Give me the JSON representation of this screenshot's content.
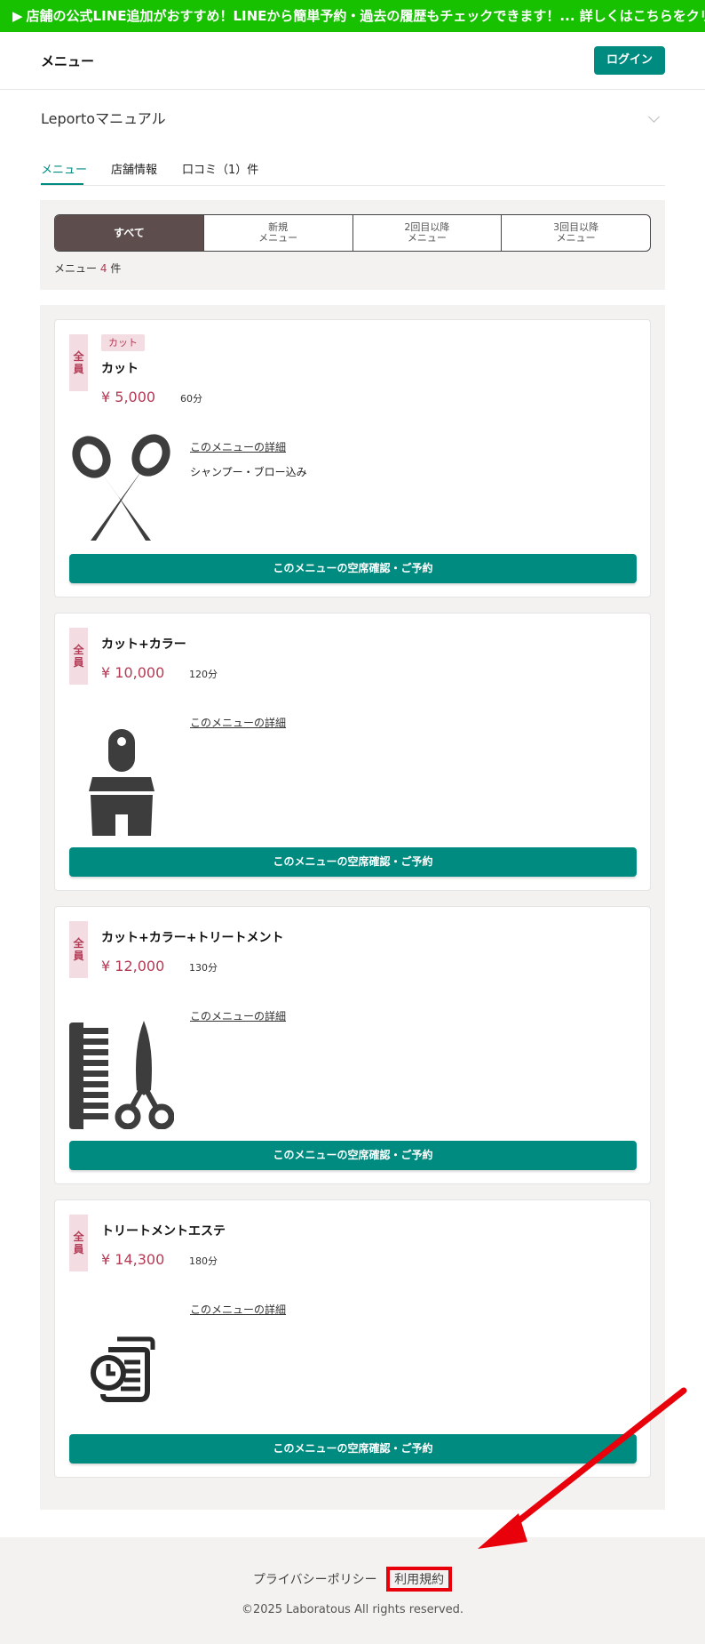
{
  "banner": {
    "arrow": "▶",
    "text": "店舗の公式LINE追加がおすすめ！LINEから簡単予約・過去の履歴もチェックできます！... 詳しくはこちらをクリック"
  },
  "header": {
    "title": "メニュー",
    "login_label": "ログイン"
  },
  "shop": {
    "name": "Leportoマニュアル"
  },
  "tabs": [
    {
      "label": "メニュー",
      "active": true
    },
    {
      "label": "店舗情報",
      "active": false
    },
    {
      "label": "口コミ（1）件",
      "active": false
    }
  ],
  "filters": {
    "segments": [
      {
        "line1": "すべて",
        "line2": "",
        "active": true
      },
      {
        "line1": "新規",
        "line2": "メニュー",
        "active": false
      },
      {
        "line1": "2回目以降",
        "line2": "メニュー",
        "active": false
      },
      {
        "line1": "3回目以降",
        "line2": "メニュー",
        "active": false
      }
    ],
    "count_prefix": "メニュー",
    "count_value": "4",
    "count_suffix": "件"
  },
  "menus": [
    {
      "badge_line1": "全",
      "badge_line2": "員",
      "category": "カット",
      "name": "カット",
      "price": "¥ 5,000",
      "duration": "60分",
      "icon": "scissors-icon",
      "detail_label": "このメニューの詳細",
      "description": "シャンプー・ブロー込み",
      "reserve_label": "このメニューの空席確認・ご予約"
    },
    {
      "badge_line1": "全",
      "badge_line2": "員",
      "category": "",
      "name": "カット+カラー",
      "price": "¥ 10,000",
      "duration": "120分",
      "icon": "paint-brush-icon",
      "detail_label": "このメニューの詳細",
      "description": "",
      "reserve_label": "このメニューの空席確認・ご予約"
    },
    {
      "badge_line1": "全",
      "badge_line2": "員",
      "category": "",
      "name": "カット+カラー+トリートメント",
      "price": "¥ 12,000",
      "duration": "130分",
      "icon": "comb-scissors-icon",
      "detail_label": "このメニューの詳細",
      "description": "",
      "reserve_label": "このメニューの空席確認・ご予約"
    },
    {
      "badge_line1": "全",
      "badge_line2": "員",
      "category": "",
      "name": "トリートメントエステ",
      "price": "¥ 14,300",
      "duration": "180分",
      "icon": "clock-document-icon",
      "detail_label": "このメニューの詳細",
      "description": "",
      "reserve_label": "このメニューの空席確認・ご予約"
    }
  ],
  "footer": {
    "privacy_label": "プライバシーポリシー",
    "terms_label": "利用規約",
    "copyright": "©2025 Laboratous All rights reserved."
  },
  "colors": {
    "banner": "#17c100",
    "accent": "#008b80",
    "price": "#b33b55",
    "segment_active": "#5d4e4d",
    "highlight": "#e8000b"
  }
}
